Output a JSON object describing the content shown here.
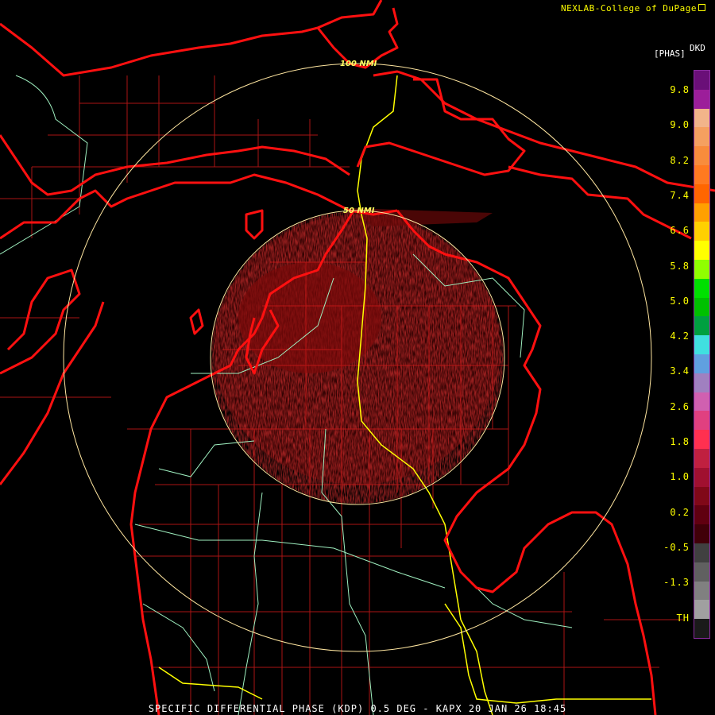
{
  "credit": "NEXLAB-College of DuPage",
  "credit_icon": "external-link-icon",
  "footer": "SPECIFIC DIFFERENTIAL PHASE (KDP) 0.5 DEG - KAPX 20 JAN 26 18:45",
  "range_rings": [
    "100 NMI",
    "50 NMI"
  ],
  "legend": {
    "unit": "[PHAS]",
    "product": "DKD",
    "ticks": [
      "9.8",
      "9.0",
      "8.2",
      "7.4",
      "6.6",
      "5.8",
      "5.0",
      "4.2",
      "3.4",
      "2.6",
      "1.8",
      "1.0",
      "0.2",
      "-0.5",
      "-1.3",
      "TH"
    ],
    "colors": [
      "#6a0f78",
      "#9c1e9a",
      "#f2b48a",
      "#f5a060",
      "#f88c3c",
      "#ff7a20",
      "#ff6600",
      "#ffa000",
      "#ffd000",
      "#ffff00",
      "#90ff00",
      "#00e000",
      "#00c000",
      "#00a040",
      "#40e0e0",
      "#60a0e0",
      "#a080c0",
      "#d060b0",
      "#e04080",
      "#ff3050",
      "#c02040",
      "#a01030",
      "#800818",
      "#600010",
      "#400008",
      "#404040",
      "#606060",
      "#808080",
      "#a0a0a0",
      "#1a1a1a"
    ]
  },
  "colors": {
    "coast": "#ff1010",
    "county": "#c81818",
    "roads": "#9ff0c0",
    "interstate": "#ffff00",
    "rings": "#ffe6a0",
    "echo": "#7a0a0a"
  }
}
